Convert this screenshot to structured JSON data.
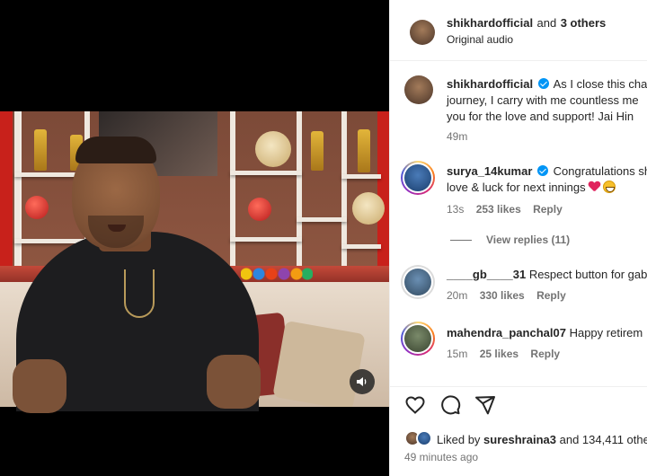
{
  "post": {
    "header": {
      "username": "shikhardofficial",
      "collab_text": "and",
      "collab_others": "3 others",
      "audio": "Original audio"
    },
    "caption": {
      "username": "shikhardofficial",
      "line1": "As I close this cha",
      "line2": "journey, I carry with me countless me",
      "line3": "you for the love and support! Jai Hin",
      "time": "49m"
    },
    "comments": [
      {
        "username": "surya_14kumar",
        "verified": true,
        "line1": "Congratulations sh",
        "line2": "love & luck for next innings",
        "time": "13s",
        "likes": "253 likes",
        "reply": "Reply",
        "view_replies": "View replies (11)"
      },
      {
        "username": "____gb____31",
        "text": "Respect button for gabb",
        "time": "20m",
        "likes": "330 likes",
        "reply": "Reply"
      },
      {
        "username": "mahendra_panchal07",
        "text": "Happy retirem",
        "time": "15m",
        "likes": "25 likes",
        "reply": "Reply"
      }
    ],
    "actions": {
      "liked_by_prefix": "Liked by",
      "liked_by_user": "sureshraina3",
      "liked_by_suffix": "and 134,411 othe",
      "timestamp": "49 minutes ago"
    },
    "icons": {
      "like": "heart-icon",
      "comment": "comment-icon",
      "share": "share-icon",
      "mute": "speaker-icon"
    },
    "colors": {
      "verified": "#0095f6",
      "secondary_text": "#737373",
      "primary_text": "#262626"
    }
  }
}
